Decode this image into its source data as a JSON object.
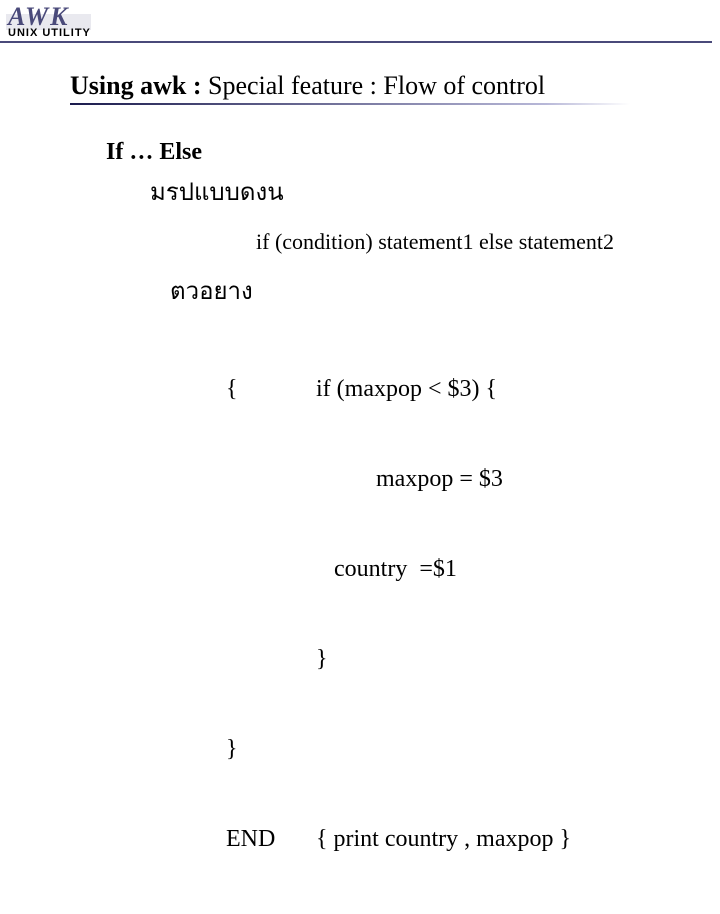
{
  "logo": {
    "title": "AWK",
    "subtitle": "UNIX UTILITY"
  },
  "title": {
    "bold": "Using awk : ",
    "rest": "Special feature : Flow of control"
  },
  "ifelse": {
    "heading": "If … Else",
    "form_label": "มรปแบบดงน",
    "syntax": "if (condition) statement1 else statement2",
    "example_label": "ตวอยาง",
    "code": {
      "l1_left": "{",
      "l1_right": "if (maxpop < $3) {",
      "l2_right": "          maxpop = $3",
      "l3_right": "   country  =$1",
      "l4_right": "}",
      "l5_left": "}",
      "l6_left": "END",
      "l6_right": "{ print country , maxpop }"
    }
  }
}
